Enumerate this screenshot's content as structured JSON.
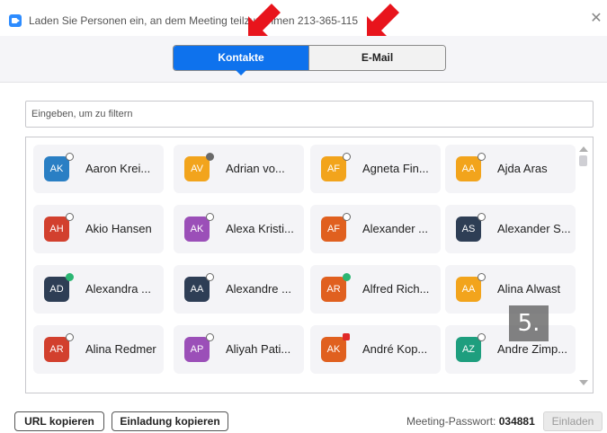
{
  "window": {
    "title": "Laden Sie Personen ein, an dem Meeting teilzunehmen 213-365-115",
    "close_glyph": "✕"
  },
  "tabs": [
    {
      "label": "Kontakte",
      "active": true
    },
    {
      "label": "E-Mail",
      "active": false
    }
  ],
  "filter": {
    "placeholder": "Eingeben, um zu filtern"
  },
  "contacts": [
    {
      "initials": "AK",
      "name": "Aaron Krei...",
      "color": "#2a7fc4",
      "status": "offline"
    },
    {
      "initials": "AV",
      "name": "Adrian vo...",
      "color": "#f2a41c",
      "status": "busy"
    },
    {
      "initials": "AF",
      "name": "Agneta Fin...",
      "color": "#f2a41c",
      "status": "offline"
    },
    {
      "initials": "AA",
      "name": "Ajda Aras",
      "color": "#f2a41c",
      "status": "offline"
    },
    {
      "initials": "AH",
      "name": "Akio Hansen",
      "color": "#d2402e",
      "status": "offline"
    },
    {
      "initials": "AK",
      "name": "Alexa Kristi...",
      "color": "#9b4fb8",
      "status": "offline"
    },
    {
      "initials": "AF",
      "name": "Alexander ...",
      "color": "#e0601f",
      "status": "offline"
    },
    {
      "initials": "AS",
      "name": "Alexander S...",
      "color": "#2e3e55",
      "status": "offline"
    },
    {
      "initials": "AD",
      "name": "Alexandra ...",
      "color": "#2e3e55",
      "status": "online"
    },
    {
      "initials": "AA",
      "name": "Alexandre ...",
      "color": "#2e3e55",
      "status": "offline"
    },
    {
      "initials": "AR",
      "name": "Alfred Rich...",
      "color": "#e0601f",
      "status": "online"
    },
    {
      "initials": "AA",
      "name": "Alina Alwast",
      "color": "#f2a41c",
      "status": "offline"
    },
    {
      "initials": "AR",
      "name": "Alina Redmer",
      "color": "#d2402e",
      "status": "offline"
    },
    {
      "initials": "AP",
      "name": "Aliyah Pati...",
      "color": "#9b4fb8",
      "status": "offline"
    },
    {
      "initials": "AK",
      "name": "André Kop...",
      "color": "#e0601f",
      "status": "camera"
    },
    {
      "initials": "AZ",
      "name": "Andre Zimp...",
      "color": "#1e9e7e",
      "status": "offline"
    }
  ],
  "step_badge": "5.",
  "footer": {
    "copy_url": "URL kopieren",
    "copy_invitation": "Einladung kopieren",
    "password_label": "Meeting-Passwort:",
    "password_value": "034881",
    "invite_button": "Einladen"
  },
  "icons": {
    "app": "zoom-camera-icon",
    "close": "close-icon",
    "arrows": "red-pointer-arrow-icon"
  }
}
